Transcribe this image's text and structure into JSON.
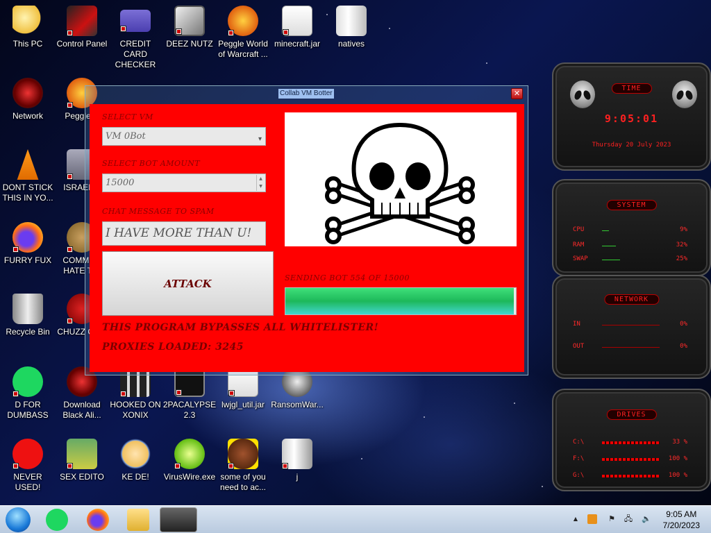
{
  "desktop": {
    "icons": [
      {
        "label": "This PC"
      },
      {
        "label": "Control Panel"
      },
      {
        "label": "CREDIT CARD CHECKER"
      },
      {
        "label": "DEEZ NUTZ"
      },
      {
        "label": "Peggle World of Warcraft ..."
      },
      {
        "label": "minecraft.jar"
      },
      {
        "label": "natives"
      },
      {
        "label": "Network"
      },
      {
        "label": "Peggle D"
      },
      {
        "label": "DONT STICK THIS IN YO..."
      },
      {
        "label": "ISRAEL S"
      },
      {
        "label": "FURRY FUX"
      },
      {
        "label": "COMMUN HATE THI"
      },
      {
        "label": "Recycle Bin"
      },
      {
        "label": "CHUZZ CUM"
      },
      {
        "label": "D FOR DUMBASS"
      },
      {
        "label": "Download Black Ali..."
      },
      {
        "label": "HOOKED ON XONIX"
      },
      {
        "label": "2PACALYPSE 2.3"
      },
      {
        "label": "lwjgl_util.jar"
      },
      {
        "label": "RansomWar..."
      },
      {
        "label": "NEVER USED!"
      },
      {
        "label": "SEX EDITO"
      },
      {
        "label": "KE DE!"
      },
      {
        "label": "VirusWire.exe"
      },
      {
        "label": "some of you need to ac..."
      },
      {
        "label": "j"
      }
    ]
  },
  "app": {
    "title": "Collab VM Botter",
    "close_glyph": "✕",
    "select_vm_label": "SELECT VM",
    "select_vm_value": "VM 0Bot",
    "bot_amount_label": "SELECT BOT AMOUNT",
    "bot_amount_value": "15000",
    "chat_label": "CHAT MESSAGE TO SPAM",
    "chat_value": "I HAVE MORE THAN U!",
    "attack_label": "ATTACK",
    "sending_status": "SENDING BOT 554 OF 15000",
    "progress_fraction": 0.99,
    "bypass_text": "THIS PROGRAM BYPASSES ALL WHITELISTER!",
    "proxies_text": "PROXIES LOADED: 3245"
  },
  "gadgets": {
    "time": {
      "header": "TIME",
      "clock": "9:05:01",
      "date": "Thursday 20 July 2023"
    },
    "system": {
      "header": "SYSTEM",
      "rows": [
        {
          "label": "CPU",
          "value": "9%"
        },
        {
          "label": "RAM",
          "value": "32%"
        },
        {
          "label": "SWAP",
          "value": "25%"
        }
      ]
    },
    "network": {
      "header": "NETWORK",
      "rows": [
        {
          "label": "IN",
          "value": "0%"
        },
        {
          "label": "OUT",
          "value": "0%"
        }
      ]
    },
    "drives": {
      "header": "DRIVES",
      "rows": [
        {
          "label": "C:\\",
          "value": "33 %"
        },
        {
          "label": "F:\\",
          "value": "100 %"
        },
        {
          "label": "G:\\",
          "value": "100 %"
        }
      ]
    }
  },
  "taskbar": {
    "time": "9:05 AM",
    "date": "7/20/2023",
    "tray_arrow": "▲"
  }
}
